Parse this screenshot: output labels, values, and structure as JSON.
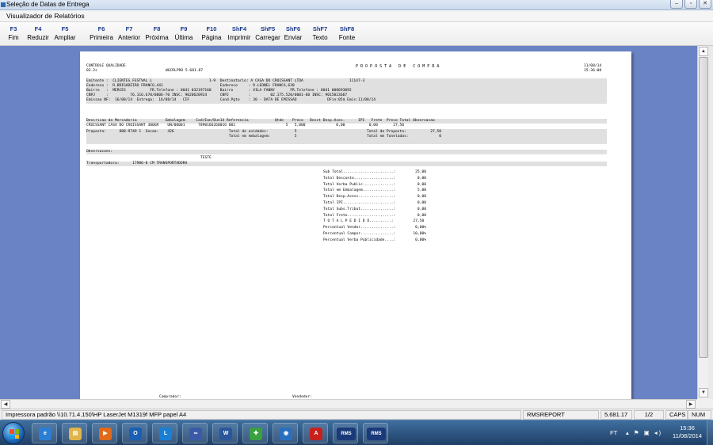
{
  "window": {
    "title": "Seleção de Datas de Entrega",
    "buttons": [
      "–",
      "▫",
      "✕"
    ]
  },
  "menu": {
    "label": "Visualizador de Relatórios"
  },
  "toolbar": {
    "buttons": [
      {
        "key": "F3",
        "label": "Fim"
      },
      {
        "key": "F4",
        "label": "Reduzir"
      },
      {
        "key": "F5",
        "label": "Ampliar"
      },
      {
        "key": "F6",
        "label": "Primeira"
      },
      {
        "key": "F7",
        "label": "Anterior"
      },
      {
        "key": "F8",
        "label": "Próxima"
      },
      {
        "key": "F9",
        "label": "Última"
      },
      {
        "key": "F10",
        "label": "Página"
      },
      {
        "key": "ShF4",
        "label": "Imprimir"
      },
      {
        "key": "ShF5",
        "label": "Carregar"
      },
      {
        "key": "ShF6",
        "label": "Enviar"
      },
      {
        "key": "ShF7",
        "label": "Texto"
      },
      {
        "key": "ShF8",
        "label": "Fonte"
      }
    ]
  },
  "report": {
    "header": {
      "left1": "CONTROLE QUALIDADE",
      "left2": "03.2s",
      "program": "WGCRLPRO 5.681.87",
      "title": "P R O P O S T A   D E   C O M P R A",
      "date": "11/08/14",
      "time": "15:36:08"
    },
    "info": [
      "Emitente :  CLIENTES_FESTVAL L                          1-9  Destinatario: A CASA DO CROISSANT LTDA                     11147-3",
      "Endereco :  R.BRIGADEIRO FRANCO,441                          Endereco     : R.LEONEL FRANCA,638",
      "Bairro   :  MERCES           FR.Telefone : 0041 032197160    Bairro       : VILA FANNY       FR.Telefone : 0041 008693092",
      "CNPJ     :          76.116.670/0006-70 INSC: 9020620924      CNPJ         :         02.175.520/0001-60 INSC: 9015023667",
      "Emissao NF:  16/08/14  Entrega:  16/08/14   CIF              Cond.Pgto    : 30 - DATA DE EMISSAO              DFin:05$ Emis:11/08/14"
    ],
    "item_header": "Descricao da Mercadoria             Embalagem     Cod/Ean/Dun14 Referencia            Qtde    Preco   Desct Desp.Aces.      IPI   Frete  Preco Total Observacao",
    "item_rows": [
      "CROISSANT CASA DO CROISSANT 300GR    UN/00001      7890166260016 001                       5   5,000              0,00           0,00       27,50",
      "Proposta:      888-9749 1  Secao:    426                         Total de unidades:            5                                Total da Proposta:           27,50",
      "                                                                 Total em embalagem:           5                                Total em Toneladas:              0"
    ],
    "obs_label": "Observacoes:",
    "obs_text": "TESTE",
    "transport": "Transportadora:      17986-8 CM TRANSPORTADORA",
    "totals": [
      "Sub Total.......................:         25,00",
      "Total Desconto..................:          0,00",
      "Total Verba Public..............:          0,00",
      "Total em Embalagem..............:          5,00",
      "Total Desp.Acess................:          0,00",
      "Total IPI.......................:          0,00",
      "Total Subs.Tribut...............:          0,00",
      "Total Frete.....................:          0,00",
      "T O T A L P E D I D O..........:         27,50",
      "Percentual Vendor...............:         0,00%",
      "Percentual Compor...............:        10,00%",
      "Percentual Verba Publicidade....:         0,00%"
    ],
    "footer_left": "Comprador:",
    "footer_right": "Vendedor:"
  },
  "status": {
    "printer": "Impressora padrão \\\\10.71.4.150\\HP LaserJet M1319f MFP papel A4",
    "module": "RMSREPORT",
    "version": "5.681.17",
    "page": "1/2",
    "caps": "CAPS",
    "num": "NUM"
  },
  "taskbar": {
    "apps": [
      {
        "icon": "internet-explorer-icon",
        "glyph": "e",
        "color": "#2a7fd4"
      },
      {
        "icon": "folder-icon",
        "glyph": "▤",
        "color": "#e0b44a"
      },
      {
        "icon": "media-player-icon",
        "glyph": "▶",
        "color": "#e06a1a"
      },
      {
        "icon": "outlook-icon",
        "glyph": "O",
        "color": "#1a5fb4"
      },
      {
        "icon": "lync-icon",
        "glyph": "L",
        "color": "#1a7fd4"
      },
      {
        "icon": "link-app-icon",
        "glyph": "∞",
        "color": "#3a5aa8"
      },
      {
        "icon": "word-icon",
        "glyph": "W",
        "color": "#2b579a"
      },
      {
        "icon": "app-green-icon",
        "glyph": "✚",
        "color": "#3aa040"
      },
      {
        "icon": "app-blue-icon",
        "glyph": "◉",
        "color": "#2a6fbf"
      },
      {
        "icon": "acrobat-icon",
        "glyph": "A",
        "color": "#c8201a"
      },
      {
        "icon": "rms-icon",
        "glyph": "RMS",
        "color": "#1a3a7a"
      },
      {
        "icon": "rms-icon",
        "glyph": "RMS",
        "color": "#1a3a7a"
      }
    ],
    "lang": "FT",
    "tray": "▴ ⚑ ▣ ◂)",
    "time": "15:36",
    "date": "11/08/2014"
  }
}
